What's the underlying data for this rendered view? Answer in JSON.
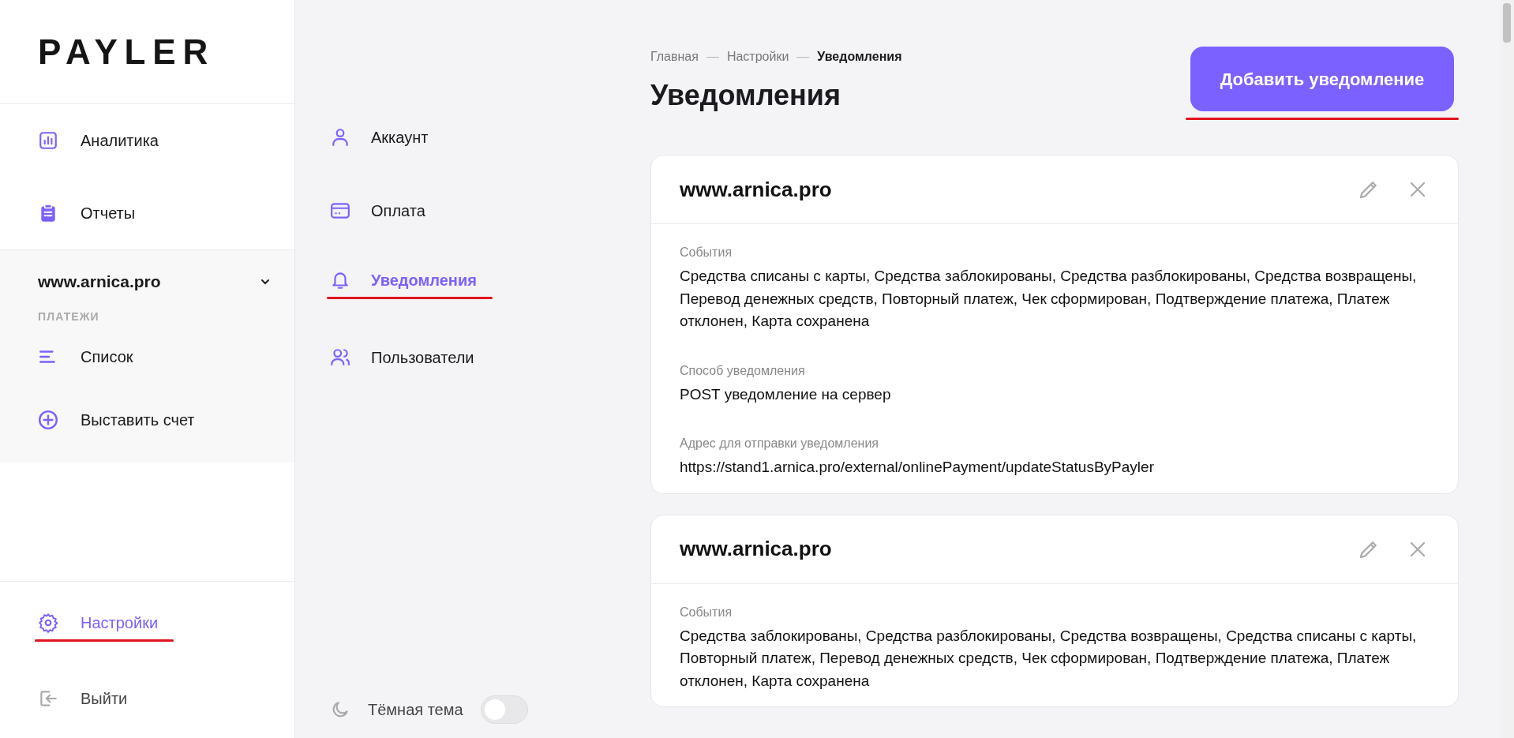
{
  "logo": "PAYLER",
  "sidebar": {
    "items": [
      {
        "label": "Аналитика",
        "selected": false
      },
      {
        "label": "Отчеты",
        "selected": false
      }
    ],
    "site": {
      "label": "www.arnica.pro",
      "expanded": true,
      "section": "ПЛАТЕЖИ",
      "items": [
        {
          "label": "Список",
          "selected": false
        },
        {
          "label": "Выставить счет",
          "selected": false
        }
      ]
    },
    "bottom_items": [
      {
        "label": "Настройки",
        "selected": true,
        "underlined": true
      },
      {
        "label": "Выйти",
        "selected": false,
        "underlined": false
      }
    ]
  },
  "settings_nav": {
    "items": [
      {
        "label": "Аккаунт",
        "selected": false,
        "underlined": false
      },
      {
        "label": "Оплата",
        "selected": false,
        "underlined": false
      },
      {
        "label": "Уведомления",
        "selected": true,
        "underlined": true
      },
      {
        "label": "Пользователи",
        "selected": false,
        "underlined": false
      }
    ],
    "dark_theme": {
      "label": "Тёмная тема",
      "on": false
    }
  },
  "breadcrumbs": [
    {
      "label": "Главная",
      "selected": false
    },
    {
      "separator": "—",
      "label": "Настройки",
      "selected": false
    },
    {
      "separator": "—",
      "label": "Уведомления",
      "selected": true
    }
  ],
  "title": "Уведомления",
  "add_button": {
    "label": "Добавить уведомление",
    "underlined": true
  },
  "cards": [
    {
      "title": "www.arnica.pro",
      "fields": [
        {
          "label": "События",
          "value": "Средства списаны с карты, Средства заблокированы, Средства разблокированы, Средства возвращены, Перевод денежных средств, Повторный платеж, Чек сформирован, Подтверждение платежа, Платеж отклонен, Карта сохранена"
        },
        {
          "label": "Способ уведомления",
          "value": "POST уведомление на сервер"
        },
        {
          "label": "Адрес для отправки уведомления",
          "value": "https://stand1.arnica.pro/external/onlinePayment/updateStatusByPayler"
        }
      ]
    },
    {
      "title": "www.arnica.pro",
      "fields": [
        {
          "label": "События",
          "value": "Средства заблокированы, Средства разблокированы, Средства возвращены, Средства списаны с карты, Повторный платеж, Перевод денежных средств, Чек сформирован, Подтверждение платежа, Платеж отклонен, Карта сохранена"
        }
      ]
    }
  ]
}
